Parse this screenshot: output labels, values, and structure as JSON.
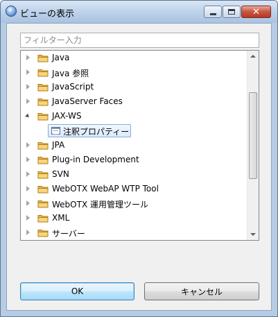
{
  "window": {
    "title": "ビューの表示",
    "close_glyph": "✕"
  },
  "filter": {
    "placeholder": "フィルター入力",
    "value": ""
  },
  "tree": {
    "items": [
      {
        "label": "Java",
        "icon": "folder-icon",
        "expanded": false
      },
      {
        "label": "Java 参照",
        "icon": "folder-icon",
        "expanded": false
      },
      {
        "label": "JavaScript",
        "icon": "folder-icon",
        "expanded": false
      },
      {
        "label": "JavaServer Faces",
        "icon": "folder-icon",
        "expanded": false
      },
      {
        "label": "JAX-WS",
        "icon": "folder-icon",
        "expanded": true
      },
      {
        "label": "注釈プロパティー",
        "icon": "view-icon",
        "child": true,
        "selected": true
      },
      {
        "label": "JPA",
        "icon": "folder-icon",
        "expanded": false
      },
      {
        "label": "Plug-in Development",
        "icon": "folder-icon",
        "expanded": false
      },
      {
        "label": "SVN",
        "icon": "folder-icon",
        "expanded": false
      },
      {
        "label": "WebOTX WebAP WTP Tool",
        "icon": "folder-icon",
        "expanded": false
      },
      {
        "label": "WebOTX 運用管理ツール",
        "icon": "folder-icon",
        "expanded": false
      },
      {
        "label": "XML",
        "icon": "folder-icon",
        "expanded": false
      },
      {
        "label": "サーバー",
        "icon": "folder-icon",
        "expanded": false
      }
    ]
  },
  "buttons": {
    "ok_label": "OK",
    "cancel_label": "キャンセル"
  }
}
